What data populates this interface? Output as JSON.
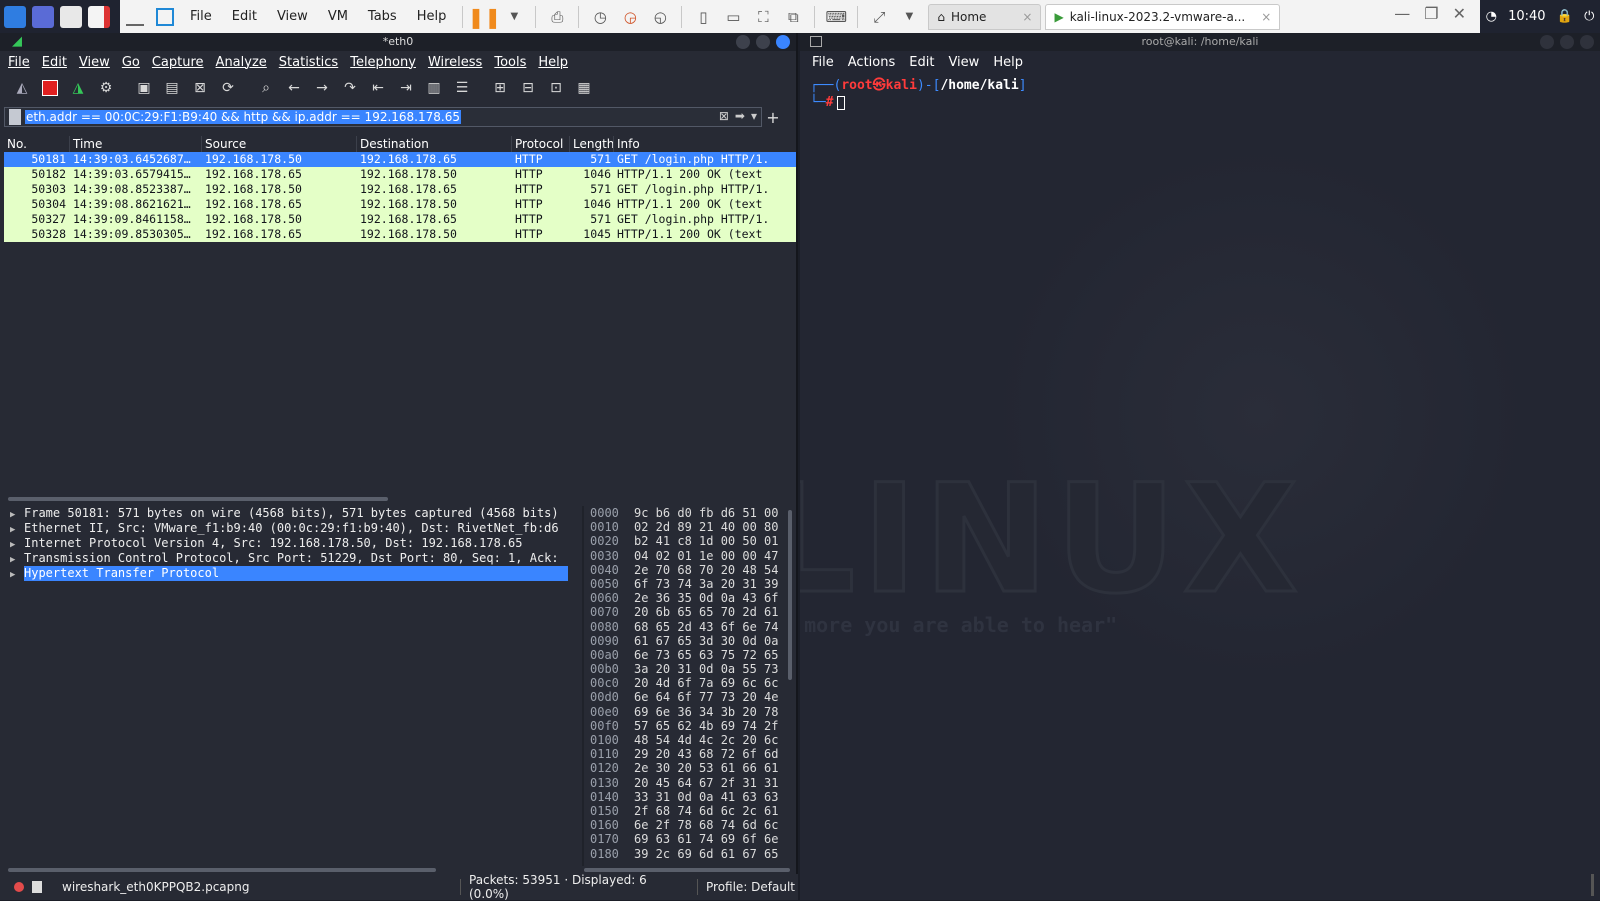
{
  "vmware": {
    "menus": [
      "File",
      "Edit",
      "View",
      "VM",
      "Tabs",
      "Help"
    ],
    "tabs": [
      {
        "label": "Home",
        "active": false
      },
      {
        "label": "kali-linux-2023.2-vmware-a...",
        "active": true
      }
    ]
  },
  "tray": {
    "clock": "10:40"
  },
  "wireshark": {
    "title": "*eth0",
    "menus": [
      "File",
      "Edit",
      "View",
      "Go",
      "Capture",
      "Analyze",
      "Statistics",
      "Telephony",
      "Wireless",
      "Tools",
      "Help"
    ],
    "filter": "eth.addr == 00:0C:29:F1:B9:40 && http && ip.addr == 192.168.178.65",
    "columns": [
      "No.",
      "Time",
      "Source",
      "Destination",
      "Protocol",
      "Length",
      "Info"
    ],
    "packets": [
      {
        "no": "50181",
        "time": "14:39:03.6452687…",
        "src": "192.168.178.50",
        "dst": "192.168.178.65",
        "proto": "HTTP",
        "len": "571",
        "info": "GET /login.php HTTP/1."
      },
      {
        "no": "50182",
        "time": "14:39:03.6579415…",
        "src": "192.168.178.65",
        "dst": "192.168.178.50",
        "proto": "HTTP",
        "len": "1046",
        "info": "HTTP/1.1 200 OK  (text"
      },
      {
        "no": "50303",
        "time": "14:39:08.8523387…",
        "src": "192.168.178.50",
        "dst": "192.168.178.65",
        "proto": "HTTP",
        "len": "571",
        "info": "GET /login.php HTTP/1."
      },
      {
        "no": "50304",
        "time": "14:39:08.8621621…",
        "src": "192.168.178.65",
        "dst": "192.168.178.50",
        "proto": "HTTP",
        "len": "1046",
        "info": "HTTP/1.1 200 OK  (text"
      },
      {
        "no": "50327",
        "time": "14:39:09.8461158…",
        "src": "192.168.178.50",
        "dst": "192.168.178.65",
        "proto": "HTTP",
        "len": "571",
        "info": "GET /login.php HTTP/1."
      },
      {
        "no": "50328",
        "time": "14:39:09.8530305…",
        "src": "192.168.178.65",
        "dst": "192.168.178.50",
        "proto": "HTTP",
        "len": "1045",
        "info": "HTTP/1.1 200 OK  (text"
      }
    ],
    "details": [
      "Frame 50181: 571 bytes on wire (4568 bits), 571 bytes captured (4568 bits)",
      "Ethernet II, Src: VMware_f1:b9:40 (00:0c:29:f1:b9:40), Dst: RivetNet_fb:d6",
      "Internet Protocol Version 4, Src: 192.168.178.50, Dst: 192.168.178.65",
      "Transmission Control Protocol, Src Port: 51229, Dst Port: 80, Seq: 1, Ack:",
      "Hypertext Transfer Protocol"
    ],
    "bytes": [
      {
        "off": "0000",
        "hex": "9c b6 d0 fb d6 51 00"
      },
      {
        "off": "0010",
        "hex": "02 2d 89 21 40 00 80"
      },
      {
        "off": "0020",
        "hex": "b2 41 c8 1d 00 50 01"
      },
      {
        "off": "0030",
        "hex": "04 02 01 1e 00 00 47"
      },
      {
        "off": "0040",
        "hex": "2e 70 68 70 20 48 54"
      },
      {
        "off": "0050",
        "hex": "6f 73 74 3a 20 31 39"
      },
      {
        "off": "0060",
        "hex": "2e 36 35 0d 0a 43 6f"
      },
      {
        "off": "0070",
        "hex": "20 6b 65 65 70 2d 61"
      },
      {
        "off": "0080",
        "hex": "68 65 2d 43 6f 6e 74"
      },
      {
        "off": "0090",
        "hex": "61 67 65 3d 30 0d 0a"
      },
      {
        "off": "00a0",
        "hex": "6e 73 65 63 75 72 65"
      },
      {
        "off": "00b0",
        "hex": "3a 20 31 0d 0a 55 73"
      },
      {
        "off": "00c0",
        "hex": "20 4d 6f 7a 69 6c 6c"
      },
      {
        "off": "00d0",
        "hex": "6e 64 6f 77 73 20 4e"
      },
      {
        "off": "00e0",
        "hex": "69 6e 36 34 3b 20 78"
      },
      {
        "off": "00f0",
        "hex": "57 65 62 4b 69 74 2f"
      },
      {
        "off": "0100",
        "hex": "48 54 4d 4c 2c 20 6c"
      },
      {
        "off": "0110",
        "hex": "29 20 43 68 72 6f 6d"
      },
      {
        "off": "0120",
        "hex": "2e 30 20 53 61 66 61"
      },
      {
        "off": "0130",
        "hex": "20 45 64 67 2f 31 31"
      },
      {
        "off": "0140",
        "hex": "33 31 0d 0a 41 63 63"
      },
      {
        "off": "0150",
        "hex": "2f 68 74 6d 6c 2c 61"
      },
      {
        "off": "0160",
        "hex": "6e 2f 78 68 74 6d 6c"
      },
      {
        "off": "0170",
        "hex": "69 63 61 74 69 6f 6e"
      },
      {
        "off": "0180",
        "hex": "39 2c 69 6d 61 67 65"
      }
    ],
    "status": {
      "file": "wireshark_eth0KPPQB2.pcapng",
      "packets": "Packets: 53951 · Displayed: 6 (0.0%)",
      "profile": "Profile: Default"
    }
  },
  "terminal": {
    "title": "root@kali: /home/kali",
    "menus": [
      "File",
      "Actions",
      "Edit",
      "View",
      "Help"
    ],
    "prompt_user": "root",
    "prompt_at": "㉿",
    "prompt_host": "kali",
    "prompt_path": "/home/kali",
    "prompt_hash": "#",
    "bg_word": "LINUX",
    "bg_quote": "e more you are able to hear\""
  },
  "colors": {
    "selected": "#3a85ff",
    "http_row": "#e4ffc7",
    "prompt_blue": "#3d8bff",
    "prompt_red": "#ff3b3b"
  }
}
